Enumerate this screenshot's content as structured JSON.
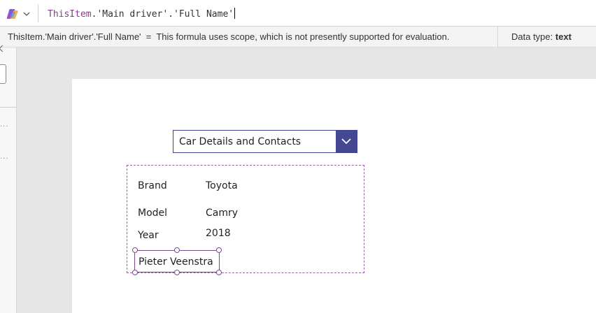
{
  "formula_bar": {
    "formula_parts": [
      "ThisItem",
      ".'Main driver'.'Full Name'"
    ],
    "copilot_icon": "copilot-icon",
    "expand_icon": "chevron-down-icon"
  },
  "info_bar": {
    "expression": "ThisItem.'Main driver'.'Full Name'",
    "equals": "=",
    "message": "This formula uses scope, which is not presently supported for evaluation.",
    "data_type_label": "Data type:",
    "data_type_value": "text"
  },
  "screen": {
    "dropdown": {
      "selected": "Car Details and Contacts",
      "icon": "chevron-down-icon"
    },
    "gallery": {
      "rows": [
        {
          "label": "Brand",
          "value": "Toyota"
        },
        {
          "label": "Model",
          "value": "Camry"
        },
        {
          "label": "Year",
          "value": "2018"
        }
      ],
      "selected_label": "Pieter Veenstra"
    }
  },
  "colors": {
    "accent": "#444791",
    "selection": "#7a4c8a",
    "keyword": "#8a3a8a"
  }
}
